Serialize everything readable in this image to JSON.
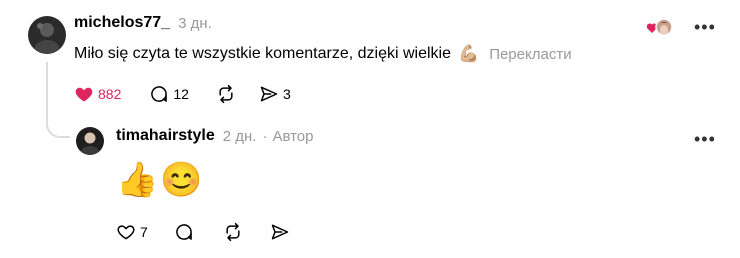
{
  "comment": {
    "username": "michelos77_",
    "time": "3 дн.",
    "text": "Miło się czyta te wszystkie komentarze, dzięki wielkie",
    "emoji": "💪🏼",
    "translate_label": "Перекласти",
    "likes": "882",
    "replies": "12",
    "shares": "3",
    "like_color": "#e0245e"
  },
  "reply": {
    "username": "timahairstyle",
    "time": "2 дн.",
    "separator": "·",
    "role": "Автор",
    "emoji": "👍😊",
    "likes": "7"
  },
  "icons": [
    "like-heart-icon",
    "comment-icon",
    "repost-icon",
    "share-icon",
    "more-icon"
  ]
}
